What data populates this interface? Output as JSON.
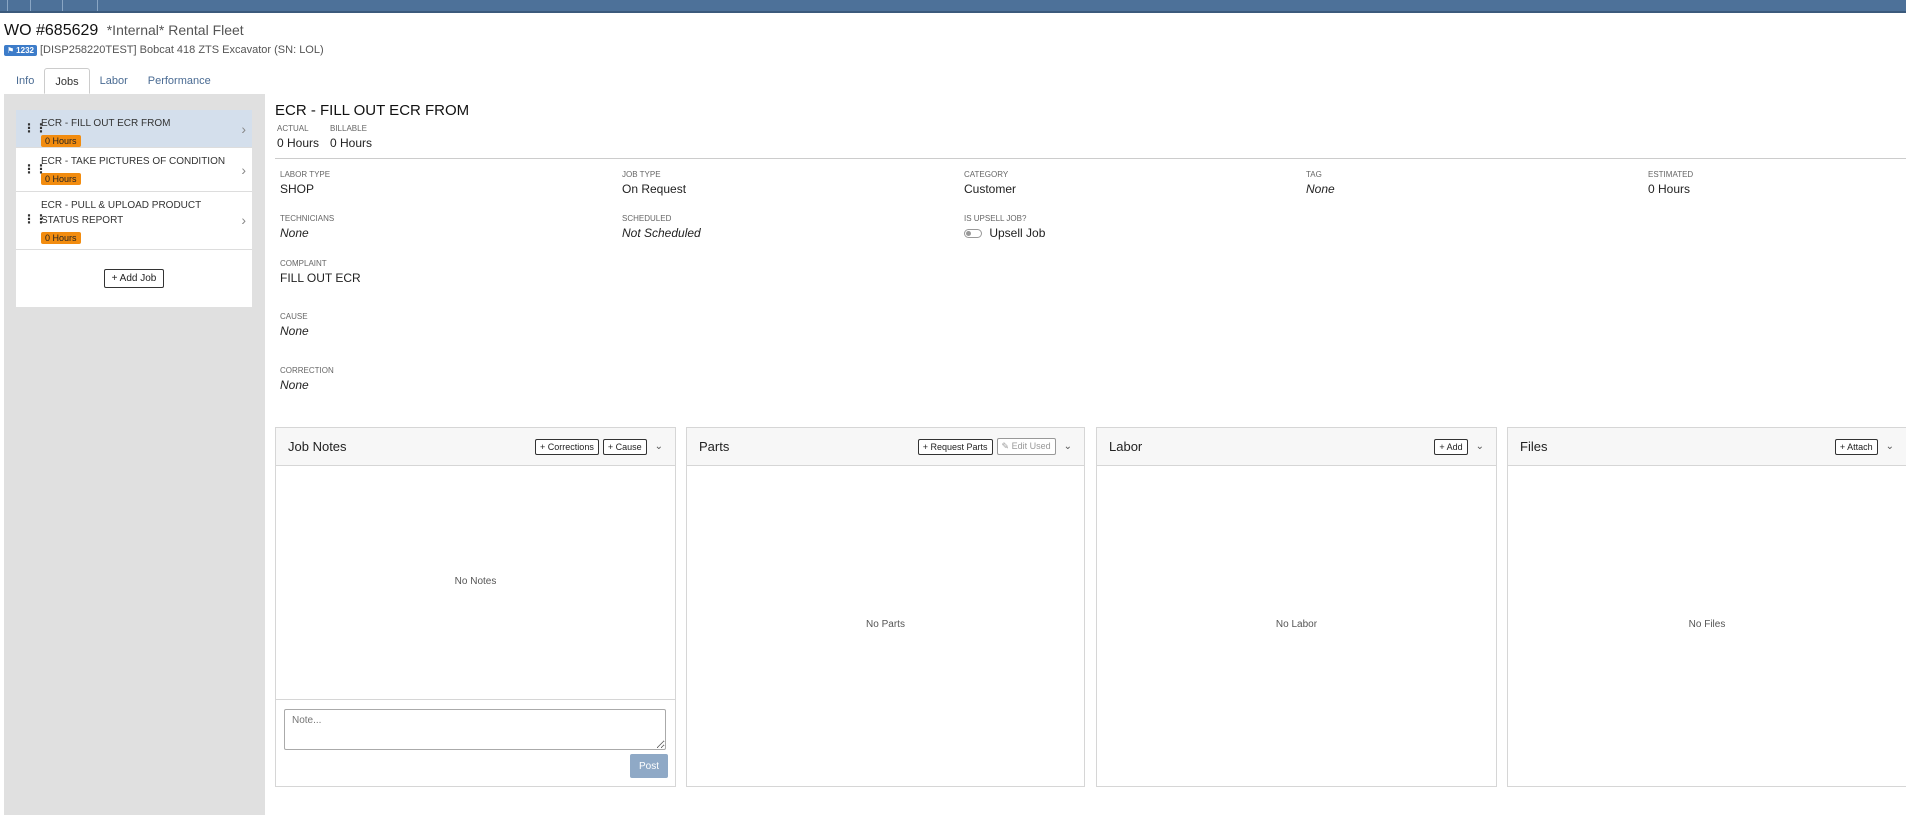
{
  "header": {
    "wo_number": "WO #685629",
    "fleet": "*Internal* Rental Fleet",
    "tag_count": "1232",
    "equipment": "[DISP258220TEST] Bobcat 418 ZTS Excavator (SN: LOL)"
  },
  "tabs": [
    {
      "label": "Info"
    },
    {
      "label": "Jobs"
    },
    {
      "label": "Labor"
    },
    {
      "label": "Performance"
    }
  ],
  "jobs": [
    {
      "title": "ECR - FILL OUT ECR FROM",
      "hours": "0 Hours"
    },
    {
      "title": "ECR - TAKE PICTURES OF CONDITION",
      "hours": "0 Hours"
    },
    {
      "title": "ECR - PULL & UPLOAD PRODUCT STATUS REPORT",
      "hours": "0 Hours"
    }
  ],
  "add_job_label": "+ Add Job",
  "job": {
    "title": "ECR - FILL OUT ECR FROM",
    "actual_label": "ACTUAL",
    "actual_value": "0 Hours",
    "billable_label": "BILLABLE",
    "billable_value": "0 Hours",
    "labor_type_label": "LABOR TYPE",
    "labor_type_value": "SHOP",
    "job_type_label": "JOB TYPE",
    "job_type_value": "On Request",
    "category_label": "CATEGORY",
    "category_value": "Customer",
    "tag_label": "TAG",
    "tag_value": "None",
    "estimated_label": "ESTIMATED",
    "estimated_value": "0 Hours",
    "technicians_label": "TECHNICIANS",
    "technicians_value": "None",
    "scheduled_label": "SCHEDULED",
    "scheduled_value": "Not Scheduled",
    "upsell_label": "IS UPSELL JOB?",
    "upsell_value": "Upsell Job",
    "complaint_label": "COMPLAINT",
    "complaint_value": "FILL OUT ECR",
    "cause_label": "CAUSE",
    "cause_value": "None",
    "correction_label": "CORRECTION",
    "correction_value": "None"
  },
  "panels": {
    "notes": {
      "title": "Job Notes",
      "btn1": "+ Corrections",
      "btn2": "+ Cause",
      "empty": "No Notes",
      "placeholder": "Note...",
      "post": "Post"
    },
    "parts": {
      "title": "Parts",
      "btn1": "+ Request Parts",
      "btn2": "✎ Edit Used",
      "empty": "No Parts"
    },
    "labor": {
      "title": "Labor",
      "btn1": "+ Add",
      "empty": "No Labor"
    },
    "files": {
      "title": "Files",
      "btn1": "+ Attach",
      "empty": "No Files"
    }
  },
  "icons": {
    "caret": "chevron-down-icon",
    "chevron": "chevron-right-icon",
    "drag": "drag-handle-icon",
    "tag": "tag-icon"
  },
  "colors": {
    "topbar": "#4d7199",
    "hours_badge": "#f28c0f",
    "active_job": "#d4dfec",
    "post_button": "#8fa9c6"
  }
}
